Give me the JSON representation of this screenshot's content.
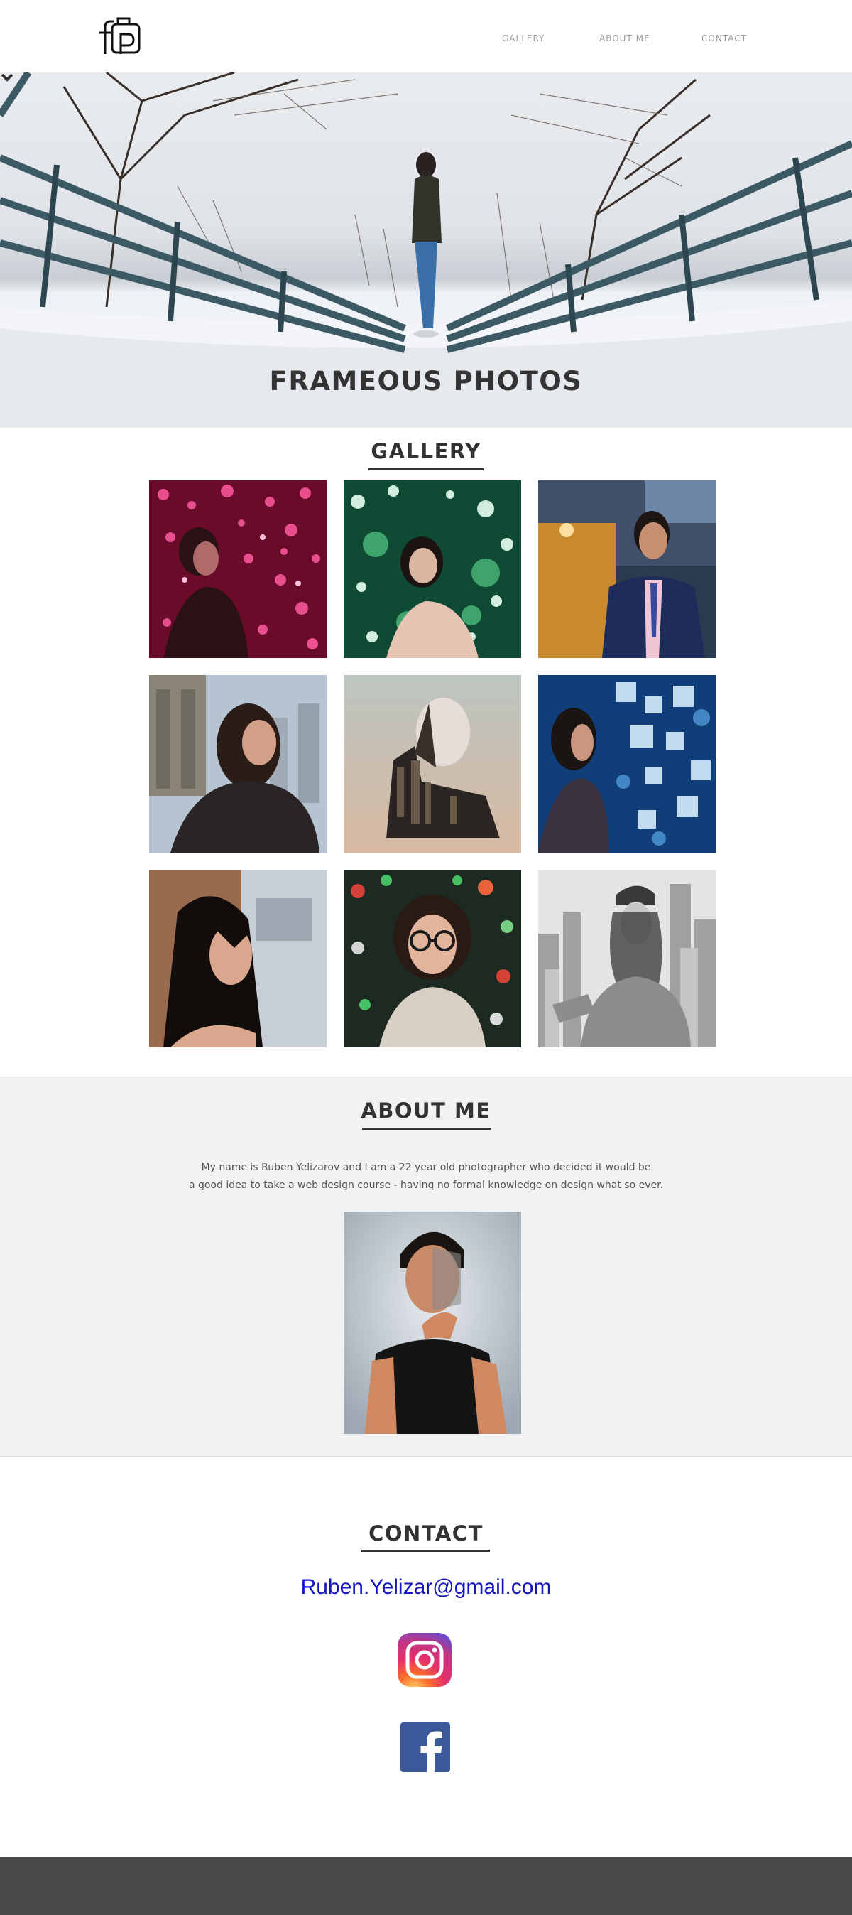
{
  "header": {
    "nav": [
      {
        "label": "GALLERY"
      },
      {
        "label": "ABOUT ME"
      },
      {
        "label": "CONTACT"
      }
    ]
  },
  "hero": {
    "title": "FRAMEOUS PHOTOS"
  },
  "gallery": {
    "title": "GALLERY",
    "photos": [
      {
        "subject": "woman-pink-bokeh"
      },
      {
        "subject": "woman-green-lights"
      },
      {
        "subject": "man-in-suit"
      },
      {
        "subject": "woman-city-bridge"
      },
      {
        "subject": "double-exposure-man-city"
      },
      {
        "subject": "woman-blue-bokeh"
      },
      {
        "subject": "woman-dark-hair-profile"
      },
      {
        "subject": "woman-glasses-lights"
      },
      {
        "subject": "woman-black-white-city"
      }
    ]
  },
  "about": {
    "title": "ABOUT ME",
    "text_line1": "My name is Ruben Yelizarov and I am a 22 year old photographer who decided it would be",
    "text_line2": "a good idea to take a web design course - having no formal knowledge on design what so ever."
  },
  "contact": {
    "title": "CONTACT",
    "email": "Ruben.Yelizar@gmail.com",
    "social": [
      {
        "icon": "instagram-icon"
      },
      {
        "icon": "facebook-icon"
      }
    ]
  },
  "colors": {
    "text_dark": "#333333",
    "nav_text": "#999999",
    "email_link": "#1515c0",
    "about_bg": "#f2f2f2",
    "footer_bg": "#4a4a4a",
    "facebook_blue": "#3b5998"
  }
}
